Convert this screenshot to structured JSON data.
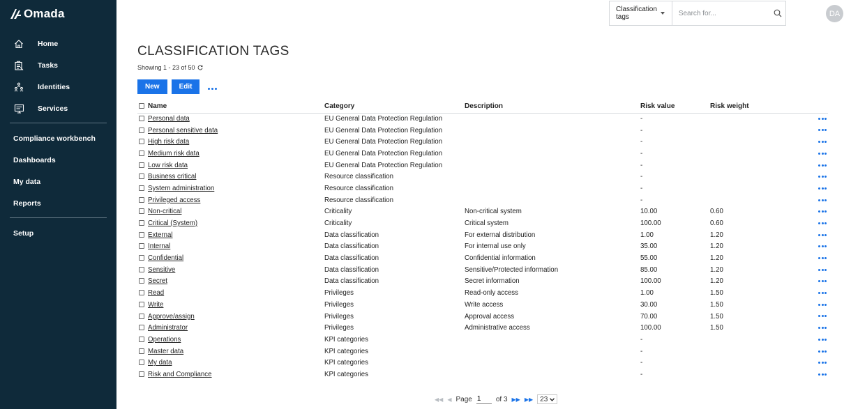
{
  "app": {
    "logo_text": "Omada"
  },
  "sidebar": {
    "items": [
      {
        "label": "Home",
        "icon": "home-icon"
      },
      {
        "label": "Tasks",
        "icon": "tasks-icon"
      },
      {
        "label": "Identities",
        "icon": "identities-icon"
      },
      {
        "label": "Services",
        "icon": "services-icon"
      }
    ],
    "sections": [
      {
        "label": "Compliance workbench"
      },
      {
        "label": "Dashboards"
      },
      {
        "label": "My data"
      },
      {
        "label": "Reports"
      }
    ],
    "setup": {
      "label": "Setup"
    }
  },
  "search": {
    "scope": "Classification tags",
    "placeholder": "Search for...",
    "icon": "search-icon"
  },
  "user": {
    "initials": "DA"
  },
  "page": {
    "title": "CLASSIFICATION TAGS",
    "showing": "Showing 1 - 23 of 50",
    "new_label": "New",
    "edit_label": "Edit"
  },
  "table": {
    "columns": [
      "Name",
      "Category",
      "Description",
      "Risk value",
      "Risk weight"
    ],
    "rows": [
      {
        "name": "Personal data",
        "category": "EU General Data Protection Regulation",
        "description": "",
        "risk_value": "-",
        "risk_weight": ""
      },
      {
        "name": "Personal sensitive data",
        "category": "EU General Data Protection Regulation",
        "description": "",
        "risk_value": "-",
        "risk_weight": ""
      },
      {
        "name": "High risk data",
        "category": "EU General Data Protection Regulation",
        "description": "",
        "risk_value": "-",
        "risk_weight": ""
      },
      {
        "name": "Medium risk data",
        "category": "EU General Data Protection Regulation",
        "description": "",
        "risk_value": "-",
        "risk_weight": ""
      },
      {
        "name": "Low risk data",
        "category": "EU General Data Protection Regulation",
        "description": "",
        "risk_value": "-",
        "risk_weight": ""
      },
      {
        "name": "Business critical",
        "category": "Resource classification",
        "description": "",
        "risk_value": "-",
        "risk_weight": ""
      },
      {
        "name": "System administration",
        "category": "Resource classification",
        "description": "",
        "risk_value": "-",
        "risk_weight": ""
      },
      {
        "name": "Privileged access",
        "category": "Resource classification",
        "description": "",
        "risk_value": "-",
        "risk_weight": ""
      },
      {
        "name": "Non-critical",
        "category": "Criticality",
        "description": "Non-critical system",
        "risk_value": "10.00",
        "risk_weight": "0.60"
      },
      {
        "name": "Critical (System)",
        "category": "Criticality",
        "description": "Critical system",
        "risk_value": "100.00",
        "risk_weight": "0.60"
      },
      {
        "name": "External",
        "category": "Data classification",
        "description": "For external distribution",
        "risk_value": "1.00",
        "risk_weight": "1.20"
      },
      {
        "name": "Internal",
        "category": "Data classification",
        "description": "For internal use only",
        "risk_value": "35.00",
        "risk_weight": "1.20"
      },
      {
        "name": "Confidential",
        "category": "Data classification",
        "description": "Confidential information",
        "risk_value": "55.00",
        "risk_weight": "1.20"
      },
      {
        "name": "Sensitive",
        "category": "Data classification",
        "description": "Sensitive/Protected information",
        "risk_value": "85.00",
        "risk_weight": "1.20"
      },
      {
        "name": "Secret",
        "category": "Data classification",
        "description": "Secret information",
        "risk_value": "100.00",
        "risk_weight": "1.20"
      },
      {
        "name": "Read",
        "category": "Privileges",
        "description": "Read-only access",
        "risk_value": "1.00",
        "risk_weight": "1.50"
      },
      {
        "name": "Write",
        "category": "Privileges",
        "description": "Write access",
        "risk_value": "30.00",
        "risk_weight": "1.50"
      },
      {
        "name": "Approve/assign",
        "category": "Privileges",
        "description": "Approval access",
        "risk_value": "70.00",
        "risk_weight": "1.50"
      },
      {
        "name": "Administrator",
        "category": "Privileges",
        "description": "Administrative access",
        "risk_value": "100.00",
        "risk_weight": "1.50"
      },
      {
        "name": "Operations",
        "category": "KPI categories",
        "description": "",
        "risk_value": "-",
        "risk_weight": ""
      },
      {
        "name": "Master data",
        "category": "KPI categories",
        "description": "",
        "risk_value": "-",
        "risk_weight": ""
      },
      {
        "name": "My data",
        "category": "KPI categories",
        "description": "",
        "risk_value": "-",
        "risk_weight": ""
      },
      {
        "name": "Risk and Compliance",
        "category": "KPI categories",
        "description": "",
        "risk_value": "-",
        "risk_weight": ""
      }
    ]
  },
  "pagination": {
    "page_label": "Page",
    "current_page": "1",
    "of_label": "of 3",
    "page_size": "23"
  },
  "colors": {
    "sidebar_bg": "#0f2a3a",
    "accent": "#1a73e8"
  }
}
